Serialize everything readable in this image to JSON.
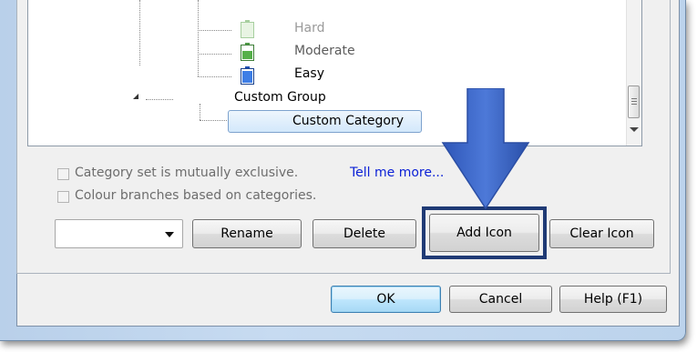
{
  "tree": {
    "nodes": [
      {
        "label": "Hard",
        "state": "dimmed"
      },
      {
        "label": "Moderate",
        "state": "normal"
      },
      {
        "label": "Easy",
        "state": "normal"
      },
      {
        "label": "Custom Group",
        "state": "normal"
      },
      {
        "label": "Custom Category",
        "state": "selected"
      }
    ],
    "icons": [
      "battery-green-empty-icon",
      "battery-green-half-icon",
      "battery-blue-icon"
    ]
  },
  "options": {
    "mutually_exclusive_label": "Category set is mutually exclusive.",
    "tell_me_more_link": "Tell me more...",
    "colour_branches_label": "Colour branches based on categories."
  },
  "actions": {
    "rename": "Rename",
    "delete": "Delete",
    "add_icon": "Add Icon",
    "clear_icon": "Clear Icon",
    "combo_value": ""
  },
  "footer": {
    "ok": "OK",
    "cancel": "Cancel",
    "help": "Help (F1)"
  },
  "colors": {
    "callout_arrow": "#3b64c4",
    "highlight_border": "#1f3a75",
    "link": "#0c21d6"
  }
}
